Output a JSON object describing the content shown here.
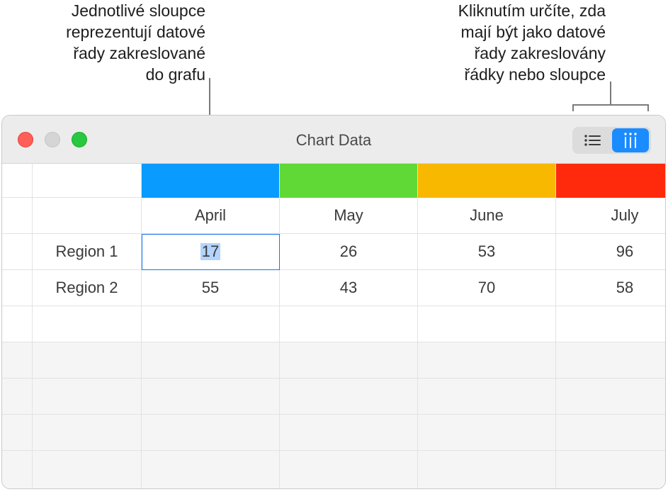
{
  "callouts": {
    "left": {
      "lines": [
        "Jednotlivé sloupce",
        "reprezentují datové",
        "řady zakreslované",
        "do grafu"
      ]
    },
    "right": {
      "lines": [
        "Kliknutím určíte, zda",
        "mají být jako datové",
        "řady zakreslovány",
        "řádky nebo sloupce"
      ]
    }
  },
  "window": {
    "title": "Chart Data",
    "plot_toggle": {
      "options": [
        "rows-icon",
        "columns-icon"
      ],
      "selected": "columns-icon",
      "accent": "#1a8cff"
    }
  },
  "table": {
    "series_colors": [
      "#0a9bff",
      "#60d836",
      "#f9b800",
      "#ff2a0b"
    ],
    "columns": [
      "April",
      "May",
      "June",
      "July"
    ],
    "rows": [
      {
        "label": "Region 1",
        "values": [
          "17",
          "26",
          "53",
          "96"
        ]
      },
      {
        "label": "Region 2",
        "values": [
          "55",
          "43",
          "70",
          "58"
        ]
      }
    ],
    "selected_cell": "Region 1 / April"
  }
}
